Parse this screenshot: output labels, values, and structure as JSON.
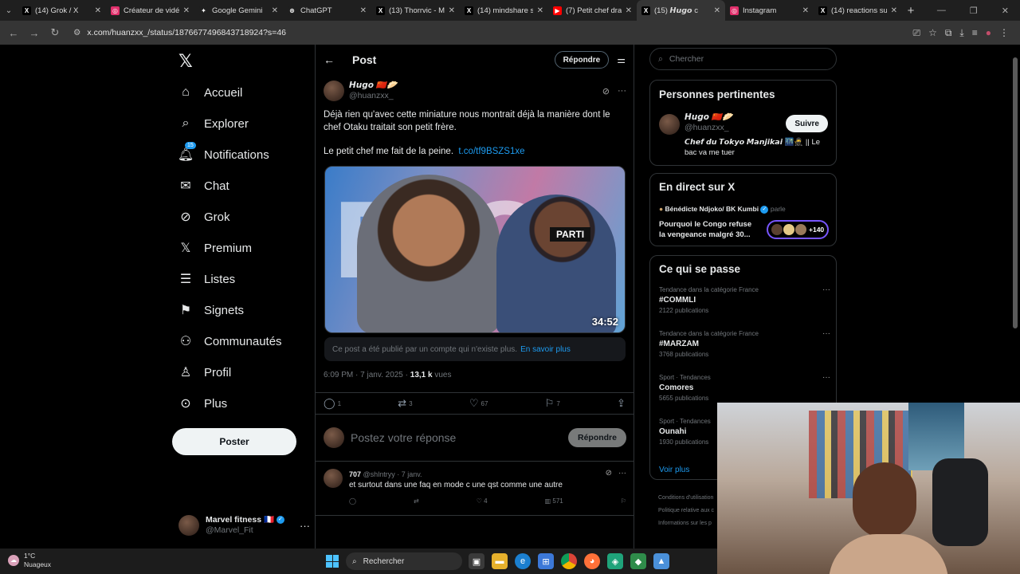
{
  "browser": {
    "tabs": [
      {
        "label": "(14) Grok / X",
        "icon": "x-icon",
        "color": "#000000",
        "glyph": "X"
      },
      {
        "label": "Créateur de vidéo",
        "icon": "instagram-icon",
        "color": "#e1306c",
        "glyph": "◎"
      },
      {
        "label": "Google Gemini",
        "icon": "gemini-icon",
        "color": "#1f1f1f",
        "glyph": "✦"
      },
      {
        "label": "ChatGPT",
        "icon": "chatgpt-icon",
        "color": "#1f1f1f",
        "glyph": "⊛"
      },
      {
        "label": "(13) Thorrvic - Me",
        "icon": "x-icon",
        "color": "#000000",
        "glyph": "X"
      },
      {
        "label": "(14) mindshare su",
        "icon": "x-icon",
        "color": "#000000",
        "glyph": "X"
      },
      {
        "label": "(7) Petit chef dram",
        "icon": "youtube-icon",
        "color": "#ff0000",
        "glyph": "▶"
      },
      {
        "label": "(15) 𝙃𝙪𝙜𝙤 c",
        "icon": "x-icon",
        "color": "#000000",
        "glyph": "X"
      },
      {
        "label": "Instagram",
        "icon": "instagram-icon",
        "color": "#e1306c",
        "glyph": "◎"
      },
      {
        "label": "(14) reactions sur",
        "icon": "x-icon",
        "color": "#000000",
        "glyph": "X"
      }
    ],
    "active_tab_index": 7,
    "url": "x.com/huanzxx_/status/1876677496843718924?s=46"
  },
  "nav": {
    "items": [
      {
        "label": "Accueil",
        "icon": "home-icon",
        "glyph": "⌂"
      },
      {
        "label": "Explorer",
        "icon": "search-icon",
        "glyph": "⌕"
      },
      {
        "label": "Notifications",
        "icon": "bell-icon",
        "glyph": "🔔︎",
        "badge": "15"
      },
      {
        "label": "Chat",
        "icon": "mail-icon",
        "glyph": "✉"
      },
      {
        "label": "Grok",
        "icon": "grok-icon",
        "glyph": "⊘"
      },
      {
        "label": "Premium",
        "icon": "x-premium-icon",
        "glyph": "𝕏"
      },
      {
        "label": "Listes",
        "icon": "list-icon",
        "glyph": "☰"
      },
      {
        "label": "Signets",
        "icon": "bookmark-icon",
        "glyph": "⚑"
      },
      {
        "label": "Communautés",
        "icon": "communities-icon",
        "glyph": "⚇"
      },
      {
        "label": "Profil",
        "icon": "profile-icon",
        "glyph": "♙"
      },
      {
        "label": "Plus",
        "icon": "more-circle-icon",
        "glyph": "⊙"
      }
    ],
    "post_button": "Poster",
    "account": {
      "name": "Marvel fitness 🇫🇷",
      "handle": "@Marvel_Fit"
    }
  },
  "post": {
    "header_title": "Post",
    "reply_header_button": "Répondre",
    "author_name": "𝙃𝙪𝙜𝙤 🇨🇳🥟",
    "author_handle": "@huanzxx_",
    "text": "Déjà rien qu'avec cette miniature nous montrait déjà la manière dont le chef Otaku traitait son petit frère.",
    "text2": "Le petit chef me fait de la peine.",
    "link": "t.co/tf9BSZS1xe",
    "media_letters": "FAQ",
    "media_label": "PARTI",
    "media_duration": "34:52",
    "notice_text": "Ce post a été publié par un compte qui n'existe plus.",
    "notice_link": "En savoir plus",
    "time": "6:09 PM · 7 janv. 2025 ·",
    "views_count": "13,1 k",
    "views_label": "vues",
    "stats": {
      "replies": "1",
      "reposts": "3",
      "likes": "67",
      "bookmarks": "7"
    },
    "compose_placeholder": "Postez votre réponse",
    "compose_button": "Répondre"
  },
  "reply": {
    "name": "707",
    "handle_date": "@shlntryy · 7 janv.",
    "text": "et surtout dans une faq en mode c une qst comme une autre",
    "likes": "4",
    "views": "571"
  },
  "sidebar": {
    "search_placeholder": "Chercher",
    "relevant_title": "Personnes pertinentes",
    "relevant": {
      "name": "𝙃𝙪𝙜𝙤 🇨🇳🥟",
      "handle": "@huanzxx_",
      "bio": "𝘾𝙝𝙚𝙛 𝙙𝙪 𝙏𝙤𝙠𝙮𝙤 𝙈𝙖𝙣𝙟𝙞𝙠𝙖𝙞 🌃🥷 || Le bac va me tuer",
      "follow_button": "Suivre"
    },
    "live_title": "En direct sur X",
    "live": {
      "host": "Bénédicte Ndjoko/ BK Kumbi",
      "status": "parle",
      "title": "Pourquoi le Congo refuse la vengeance malgré 30...",
      "extra": "+140"
    },
    "trends_title": "Ce qui se passe",
    "trends": [
      {
        "context": "Tendance dans la catégorie France",
        "name": "#COMMLI",
        "count": "2122 publications"
      },
      {
        "context": "Tendance dans la catégorie France",
        "name": "#MARZAM",
        "count": "3768 publications"
      },
      {
        "context": "Sport · Tendances",
        "name": "Comores",
        "count": "5655 publications"
      },
      {
        "context": "Sport · Tendances",
        "name": "Ounahi",
        "count": "1930 publications"
      }
    ],
    "see_more": "Voir plus",
    "footer": [
      "Conditions d'utilisation",
      "Politique relative aux c",
      "Informations sur les p"
    ]
  },
  "taskbar": {
    "temp": "1°C",
    "weather": "Nuageux",
    "search": "Rechercher"
  },
  "colors": {
    "accent": "#1d9bf0",
    "background": "#000000",
    "border": "#2f3336",
    "muted": "#71767b"
  }
}
